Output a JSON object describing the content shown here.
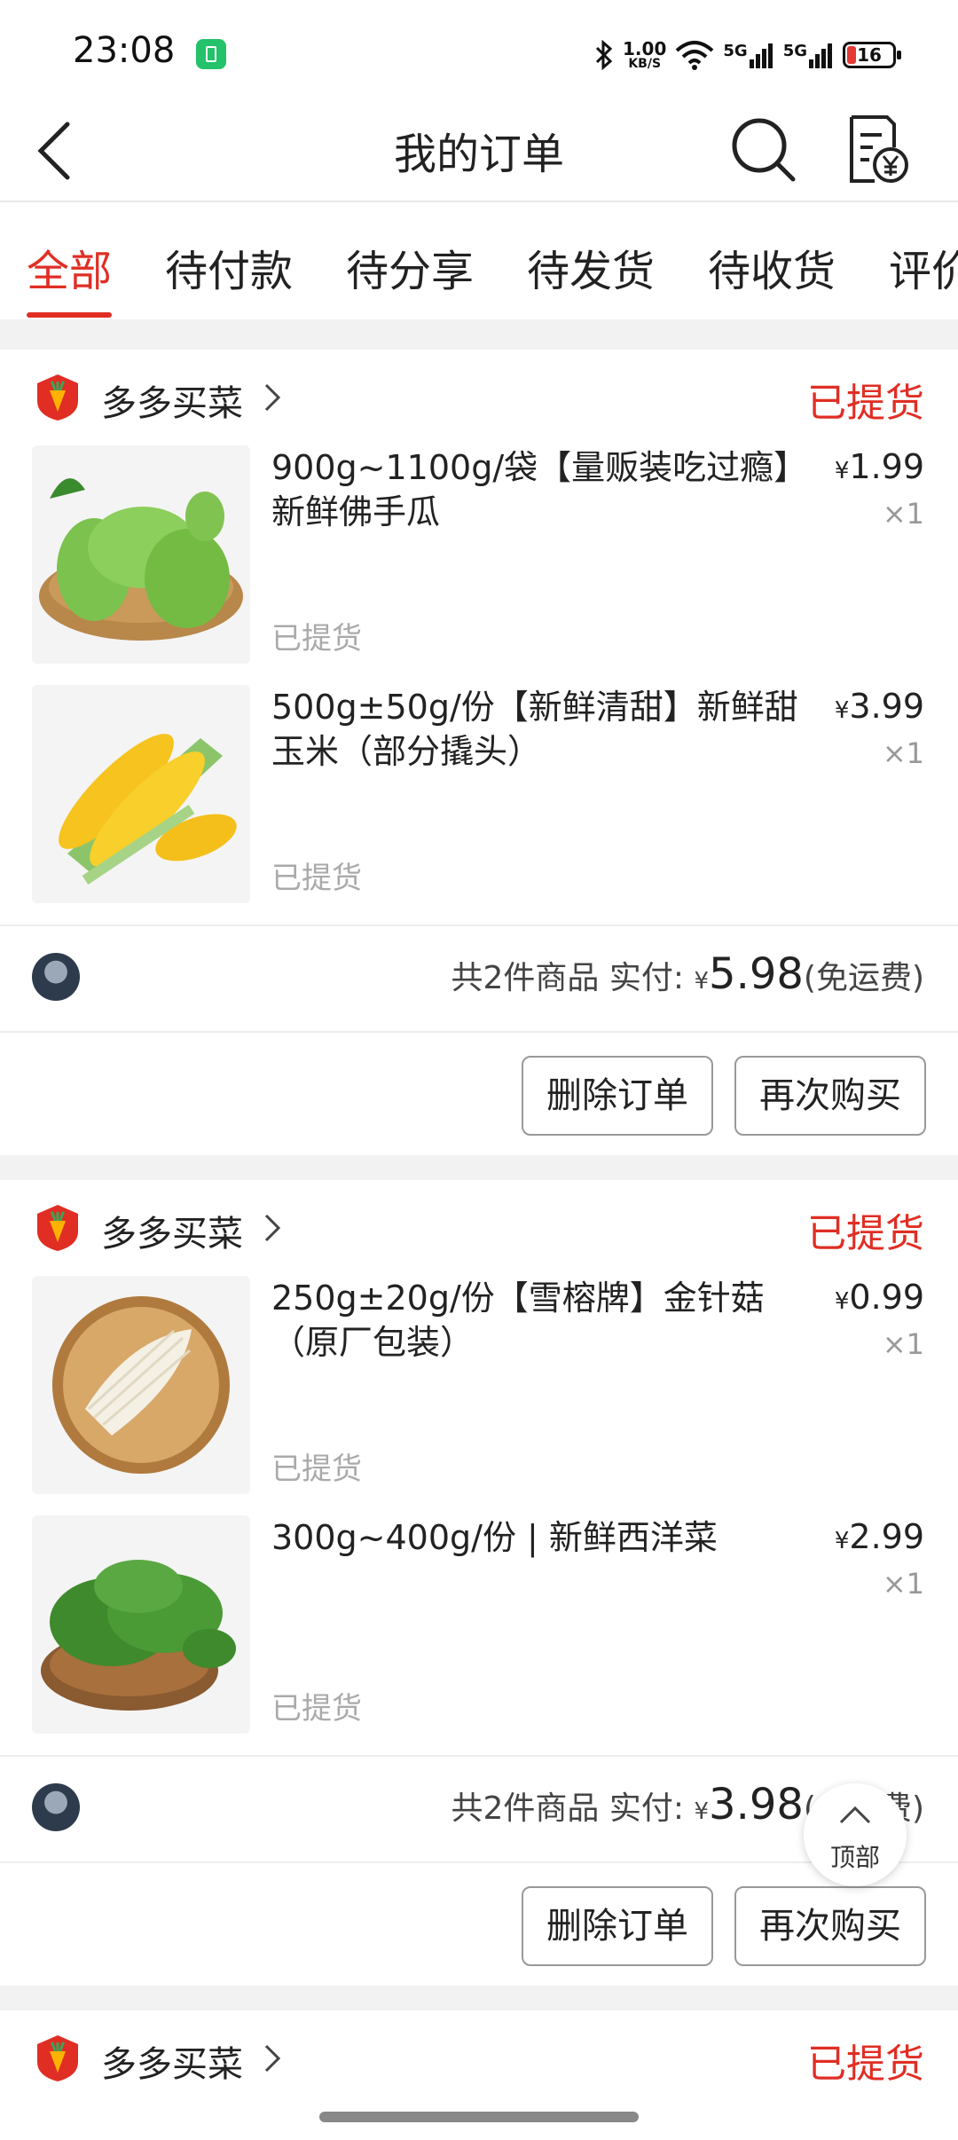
{
  "status_bar": {
    "time": "23:08",
    "net_speed_value": "1.00",
    "net_speed_unit": "KB/S",
    "signal1": "5G",
    "signal2": "5G",
    "battery": "16",
    "icons": [
      "bluetooth-icon",
      "wifi-icon",
      "signal-icon",
      "battery-icon"
    ]
  },
  "header": {
    "title": "我的订单",
    "back_icon": "chevron-left-icon",
    "search_icon": "search-icon",
    "bill_icon": "bill-icon"
  },
  "tabs": [
    {
      "label": "全部",
      "active": true
    },
    {
      "label": "待付款",
      "active": false
    },
    {
      "label": "待分享",
      "active": false
    },
    {
      "label": "待发货",
      "active": false
    },
    {
      "label": "待收货",
      "active": false
    },
    {
      "label": "评价",
      "active": false
    }
  ],
  "colors": {
    "accent": "#e02e24",
    "muted": "#999999"
  },
  "orders": [
    {
      "store": "多多买菜",
      "status": "已提货",
      "items": [
        {
          "title": "900g~1100g/袋【量贩装吃过瘾】新鲜佛手瓜",
          "currency": "¥",
          "price": "1.99",
          "qty": "×1",
          "state": "已提货",
          "image": "chayote-image"
        },
        {
          "title": "500g±50g/份【新鲜清甜】新鲜甜玉米（部分撬头）",
          "currency": "¥",
          "price": "3.99",
          "qty": "×1",
          "state": "已提货",
          "image": "corn-image"
        }
      ],
      "summary": {
        "count_text": "共2件商品",
        "paid_label": "实付:",
        "currency": "¥",
        "amount": "5.98",
        "shipping": "(免运费)"
      },
      "buttons": {
        "delete": "删除订单",
        "rebuy": "再次购买"
      }
    },
    {
      "store": "多多买菜",
      "status": "已提货",
      "items": [
        {
          "title": "250g±20g/份【雪榕牌】金针菇（原厂包装）",
          "currency": "¥",
          "price": "0.99",
          "qty": "×1",
          "state": "已提货",
          "image": "enoki-mushroom-image"
        },
        {
          "title": "300g~400g/份 | 新鲜西洋菜",
          "currency": "¥",
          "price": "2.99",
          "qty": "×1",
          "state": "已提货",
          "image": "watercress-image"
        }
      ],
      "summary": {
        "count_text": "共2件商品",
        "paid_label": "实付:",
        "currency": "¥",
        "amount": "3.98",
        "shipping": "(免运费)"
      },
      "buttons": {
        "delete": "删除订单",
        "rebuy": "再次购买"
      }
    },
    {
      "store": "多多买菜",
      "status": "已提货"
    }
  ],
  "to_top": {
    "label": "顶部"
  }
}
